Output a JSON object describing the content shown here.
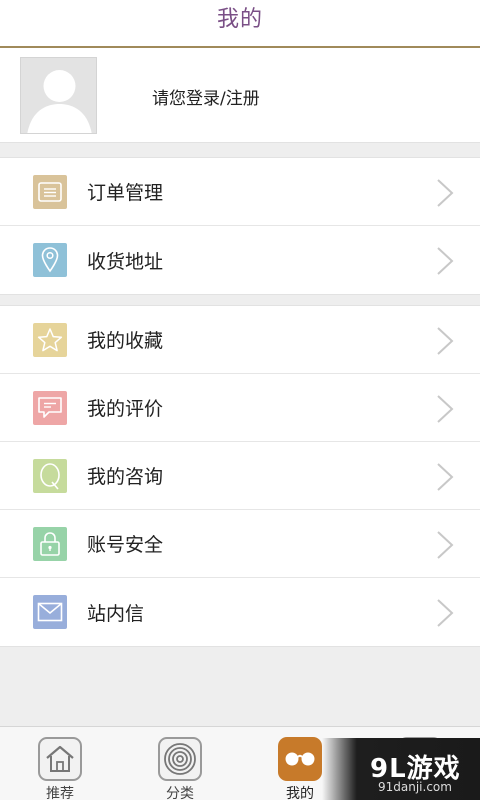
{
  "header": {
    "title": "我的"
  },
  "profile": {
    "login_text": "请您登录/注册"
  },
  "menu_group1": [
    {
      "label": "订单管理",
      "icon": "order-list-icon",
      "color": "#d9c39a"
    },
    {
      "label": "收货地址",
      "icon": "location-pin-icon",
      "color": "#8fc1d8"
    }
  ],
  "menu_group2": [
    {
      "label": "我的收藏",
      "icon": "star-icon",
      "color": "#e6d49a"
    },
    {
      "label": "我的评价",
      "icon": "comment-icon",
      "color": "#eea6a6"
    },
    {
      "label": "我的咨询",
      "icon": "question-icon",
      "color": "#c6db9c"
    },
    {
      "label": "账号安全",
      "icon": "lock-icon",
      "color": "#97d3a8"
    },
    {
      "label": "站内信",
      "icon": "mail-icon",
      "color": "#98aedb"
    }
  ],
  "tabbar": [
    {
      "label": "推荐",
      "icon": "home-icon"
    },
    {
      "label": "分类",
      "icon": "category-icon"
    },
    {
      "label": "我的",
      "icon": "profile-glasses-icon",
      "active": true,
      "active_color": "#c77a2a"
    },
    {
      "label": "",
      "icon": "more-icon"
    }
  ],
  "watermark": {
    "logo": "9L游戏",
    "url": "91danji.com"
  }
}
